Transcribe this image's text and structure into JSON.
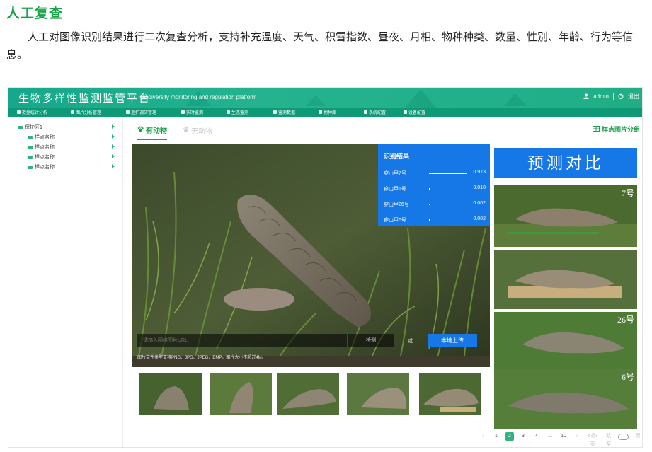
{
  "doc": {
    "title": "人工复查",
    "paragraph": "人工对图像识别结果进行二次复查分析，支持补充温度、天气、积雪指数、昼夜、月相、物种种类、数量、性别、年龄、行为等信息。"
  },
  "app": {
    "title": "生物多样性监测监管平台",
    "subtitle": "Biodiversity monitoring and regulation platform",
    "user": "admin",
    "logout": "退出"
  },
  "nav": [
    {
      "label": "数据统计分析",
      "icon": "chart-icon"
    },
    {
      "label": "图片分析管理",
      "icon": "image-icon"
    },
    {
      "label": "巡护调研管理",
      "icon": "patrol-icon"
    },
    {
      "label": "实时监测",
      "icon": "camera-icon"
    },
    {
      "label": "生态监测",
      "icon": "leaf-icon"
    },
    {
      "label": "监测数据",
      "icon": "database-icon"
    },
    {
      "label": "物种库",
      "icon": "book-icon"
    },
    {
      "label": "系统配置",
      "icon": "gear-icon"
    },
    {
      "label": "设备配置",
      "icon": "device-icon"
    }
  ],
  "sidebar": {
    "root": "保护区1",
    "items": [
      "样点名称",
      "样点名称",
      "样点名称",
      "样点名称"
    ]
  },
  "tabs": {
    "active": "有动物",
    "inactive": "无动物",
    "group_link": "样点图片分组"
  },
  "result": {
    "title": "识别结果",
    "rows": [
      {
        "label": "穿山甲7号",
        "value": "0.973",
        "fraction": 0.973
      },
      {
        "label": "穿山甲1号",
        "value": "0.018",
        "fraction": 0.018
      },
      {
        "label": "穿山甲26号",
        "value": "0.002",
        "fraction": 0.002
      },
      {
        "label": "穿山甲6号",
        "value": "0.002",
        "fraction": 0.002
      }
    ]
  },
  "search": {
    "placeholder": "请输入网络图片URL",
    "detect": "检测",
    "or": "或",
    "upload": "本地上传",
    "hint": "图片文件类型支持PNG、JPG、JPEG、BMP，图片大小不超过4M。"
  },
  "compare": {
    "title": "预测对比",
    "labels": [
      "7号",
      "",
      "26号",
      "6号"
    ]
  },
  "pager": {
    "prev": "‹",
    "pages": [
      "1",
      "2",
      "3",
      "4",
      "...",
      "10"
    ],
    "next": "›",
    "per_page": "6条/页",
    "jump": "跳至",
    "unit": "页"
  },
  "colors": {
    "brand_green": "#1aa14a",
    "header_green": "#15a88a",
    "accent_blue": "#1677e6"
  }
}
